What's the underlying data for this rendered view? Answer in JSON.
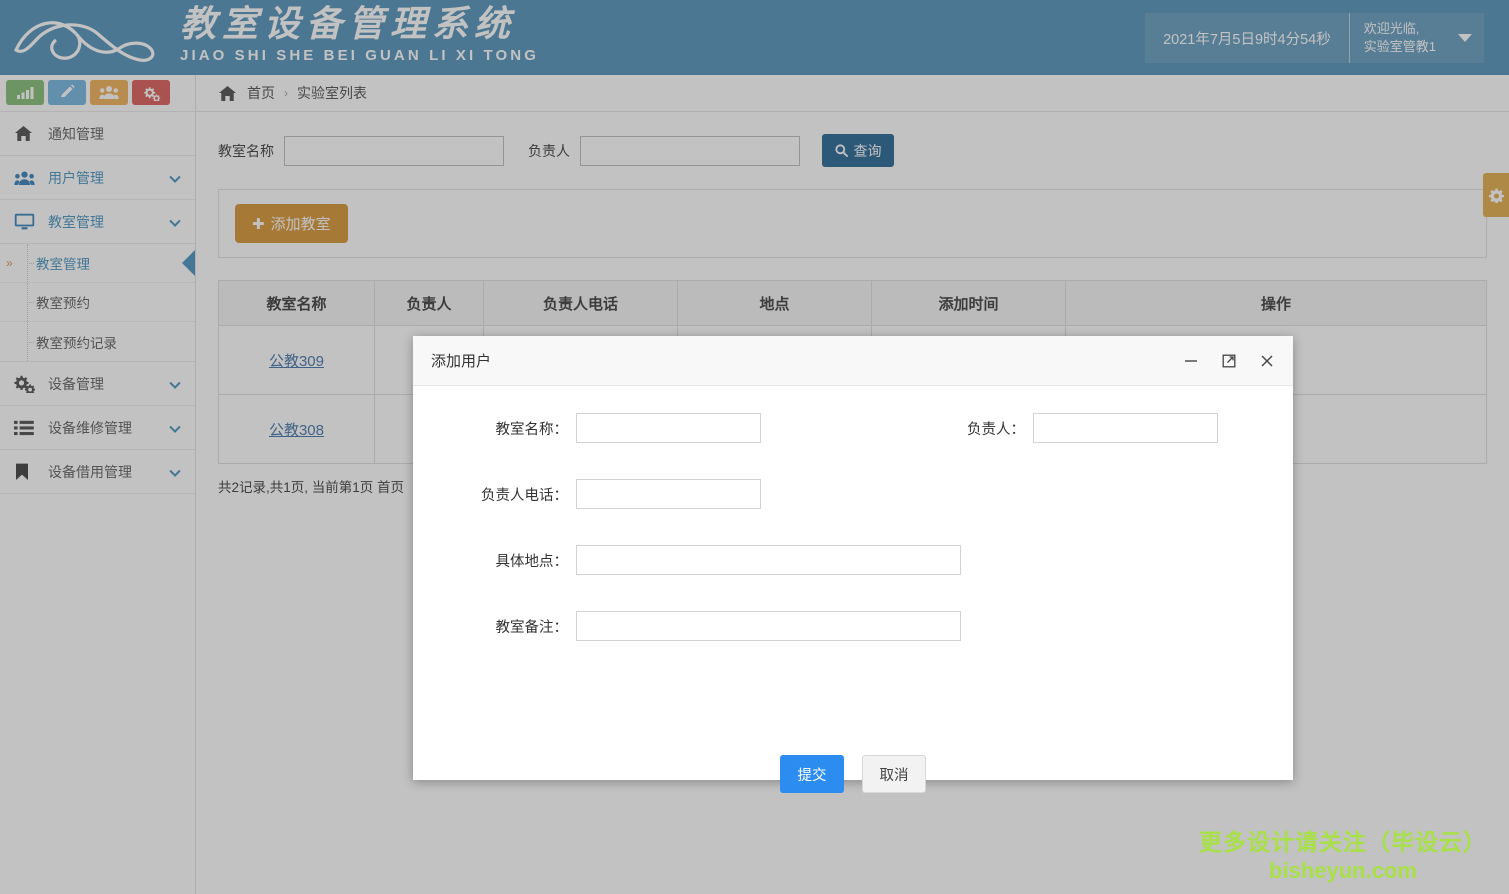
{
  "header": {
    "logo_cn": "教室设备管理系统",
    "logo_pinyin": "JIAO SHI SHE BEI GUAN LI XI TONG",
    "datetime": "2021年7月5日9时4分54秒",
    "welcome_line1": "欢迎光临,",
    "welcome_line2": "实验室管教1"
  },
  "quick_icons": [
    {
      "name": "chart-icon",
      "color": "#7cbb6e"
    },
    {
      "name": "pencil-icon",
      "color": "#6cb2dd"
    },
    {
      "name": "users-icon",
      "color": "#f0ad4e"
    },
    {
      "name": "gears-icon",
      "color": "#d9534f"
    }
  ],
  "sidebar": {
    "items": [
      {
        "label": "通知管理",
        "icon": "home-icon",
        "has_caret": false,
        "highlight": false
      },
      {
        "label": "用户管理",
        "icon": "users-icon",
        "has_caret": true,
        "highlight": true
      },
      {
        "label": "教室管理",
        "icon": "monitor-icon",
        "has_caret": true,
        "highlight": true
      }
    ],
    "submenu": [
      {
        "label": "教室管理",
        "active": true
      },
      {
        "label": "教室预约",
        "active": false
      },
      {
        "label": "教室预约记录",
        "active": false
      }
    ],
    "items_after": [
      {
        "label": "设备管理",
        "icon": "gears-icon",
        "has_caret": true
      },
      {
        "label": "设备维修管理",
        "icon": "list-icon",
        "has_caret": true
      },
      {
        "label": "设备借用管理",
        "icon": "bookmark-icon",
        "has_caret": true
      }
    ]
  },
  "breadcrumb": {
    "home": "首页",
    "separator": "›",
    "current": "实验室列表"
  },
  "search": {
    "label_name": "教室名称",
    "value_name": "",
    "placeholder_name": "",
    "label_owner": "负责人",
    "value_owner": "",
    "placeholder_owner": "",
    "button": "查询"
  },
  "toolbar": {
    "add_label": "添加教室",
    "add_plus": "✚"
  },
  "table": {
    "columns": [
      "教室名称",
      "负责人",
      "负责人电话",
      "地点",
      "添加时间",
      "操作"
    ],
    "rows": [
      {
        "name": "公教309",
        "owner": "",
        "phone": "",
        "place": "",
        "time": "",
        "action": "delete"
      },
      {
        "name": "公教308",
        "owner": "",
        "phone": "",
        "place": "",
        "time": "",
        "action": "delete"
      }
    ]
  },
  "pagination": {
    "text": "共2记录,共1页, 当前第1页 首页"
  },
  "settings_tab": {
    "icon": "gear-icon",
    "color": "#e0a63f"
  },
  "modal": {
    "title": "添加用户",
    "controls": {
      "minimize": "—",
      "maximize": "⤢",
      "close": "✕"
    },
    "fields": [
      {
        "label": "教室名称：",
        "value": "",
        "placeholder": "",
        "name": "classroom-name-field"
      },
      {
        "label": "负责人：",
        "value": "",
        "placeholder": "",
        "name": "owner-field"
      },
      {
        "label": "负责人电话：",
        "value": "",
        "placeholder": "",
        "name": "owner-phone-field"
      },
      {
        "label": "具体地点：",
        "value": "",
        "placeholder": "",
        "name": "address-field"
      },
      {
        "label": "教室备注：",
        "value": "",
        "placeholder": "",
        "name": "remark-field"
      }
    ],
    "submit": "提交",
    "cancel": "取消"
  },
  "watermark": {
    "line1": "更多设计请关注（毕设云）",
    "line2": "bisheyun.com",
    "color": "#a8e048"
  },
  "colors": {
    "header_blue": "#4a8cb5",
    "accent_blue": "#3c8dbc",
    "search_button": "#1b5e8e",
    "orange": "#d69029",
    "primary_button": "#2d8cf0"
  }
}
